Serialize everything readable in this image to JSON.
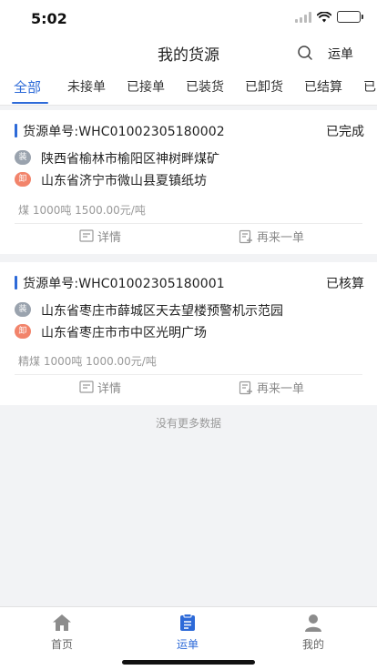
{
  "status": {
    "time": "5:02"
  },
  "nav": {
    "title": "我的货源",
    "right_label": "运单"
  },
  "tabs": [
    {
      "label": "全部",
      "active": true
    },
    {
      "label": "未接单"
    },
    {
      "label": "已接单"
    },
    {
      "label": "已装货"
    },
    {
      "label": "已卸货"
    },
    {
      "label": "已结算"
    },
    {
      "label": "已"
    }
  ],
  "orders": [
    {
      "id_label": "货源单号:WHC01002305180002",
      "status": "已完成",
      "load_badge": "装",
      "load_addr": "陕西省榆林市榆阳区神树畔煤矿",
      "unload_badge": "卸",
      "unload_addr": "山东省济宁市微山县夏镇纸坊",
      "meta": "煤 1000吨 1500.00元/吨",
      "detail_label": "详情",
      "again_label": "再来一单"
    },
    {
      "id_label": "货源单号:WHC01002305180001",
      "status": "已核算",
      "load_badge": "装",
      "load_addr": "山东省枣庄市薛城区天去望楼预警机示范园",
      "unload_badge": "卸",
      "unload_addr": "山东省枣庄市市中区光明广场",
      "meta": "精煤 1000吨 1000.00元/吨",
      "detail_label": "详情",
      "again_label": "再来一单"
    }
  ],
  "no_more": "没有更多数据",
  "tabbar": [
    {
      "label": "首页",
      "icon": "home-icon"
    },
    {
      "label": "运单",
      "icon": "waybill-icon",
      "active": true
    },
    {
      "label": "我的",
      "icon": "profile-icon"
    }
  ],
  "colors": {
    "accent": "#2d6ad8",
    "load_badge": "#9aa3ae",
    "unload_badge": "#f2846b",
    "battery": "#4cd964"
  }
}
